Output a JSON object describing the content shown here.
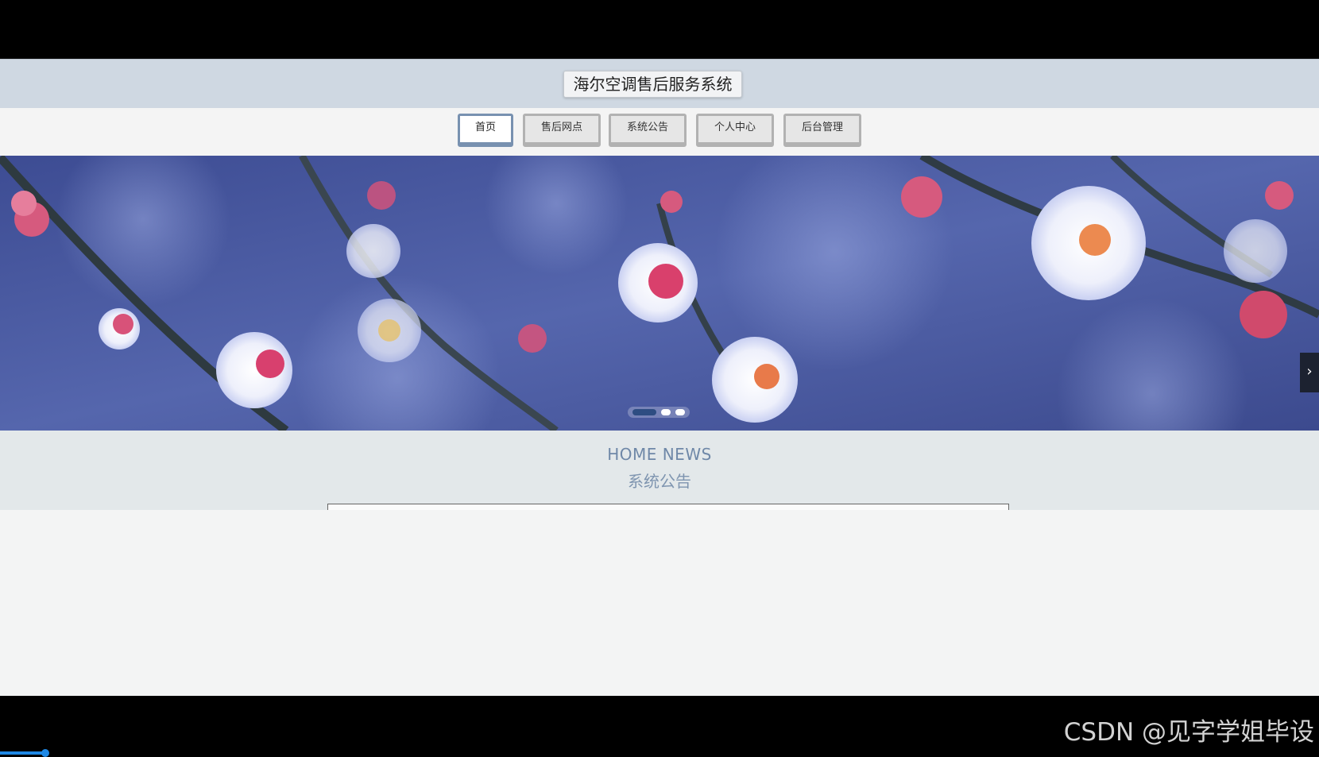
{
  "header": {
    "title": "海尔空调售后服务系统"
  },
  "nav": {
    "items": [
      {
        "label": "首页",
        "active": true
      },
      {
        "label": "售后网点",
        "active": false
      },
      {
        "label": "系统公告",
        "active": false
      },
      {
        "label": "个人中心",
        "active": false
      },
      {
        "label": "后台管理",
        "active": false
      }
    ]
  },
  "carousel": {
    "slide_count": 3,
    "active_slide": 1,
    "next_icon": "chevron-right-icon",
    "next_label": "›"
  },
  "news": {
    "title_en": "HOME NEWS",
    "title_cn": "系统公告"
  },
  "watermark": "CSDN @见字学姐毕设",
  "colors": {
    "header_bg": "#cfd8e2",
    "active_nav_border": "#7891b0",
    "news_title": "#6f88a8",
    "banner_bg": "#4a5a9c",
    "player_progress": "#1e88e5"
  }
}
